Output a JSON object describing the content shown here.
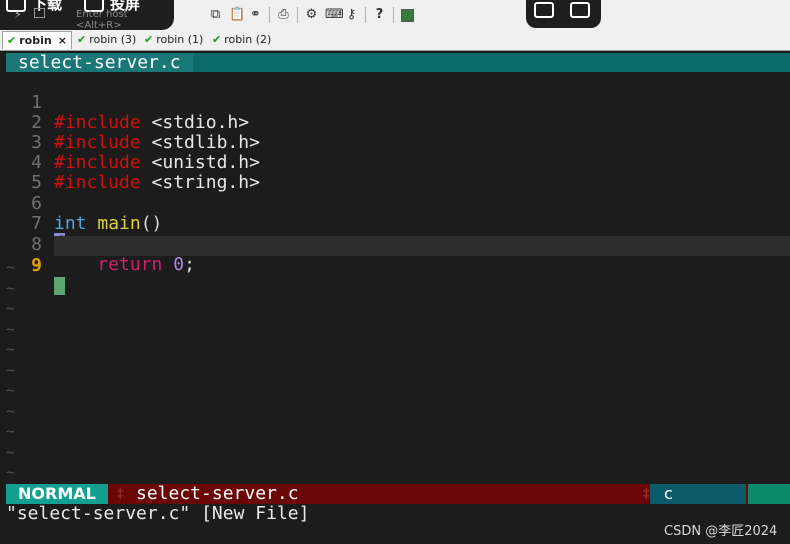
{
  "overlay": {
    "download_label": "下载",
    "cast_label": "投屏",
    "host_placeholder": "Enter host <Alt+R>"
  },
  "tabs": [
    {
      "label": "robin",
      "active": true
    },
    {
      "label": "robin (3)",
      "active": false
    },
    {
      "label": "robin (1)",
      "active": false
    },
    {
      "label": "robin (2)",
      "active": false
    }
  ],
  "tab_close_glyph": "×",
  "editor": {
    "buffer_tab": "select-server.c",
    "lines": [
      {
        "num": "1",
        "text": "#include <stdio.h>"
      },
      {
        "num": "2",
        "text": "#include <stdlib.h>"
      },
      {
        "num": "3",
        "text": "#include <unistd.h>"
      },
      {
        "num": "4",
        "text": "#include <string.h>"
      },
      {
        "num": "5",
        "text": ""
      },
      {
        "num": "6",
        "text": "int main()"
      },
      {
        "num": "7",
        "text": "{"
      },
      {
        "num": "8",
        "text": "    return 0;"
      },
      {
        "num": "9",
        "text": ""
      }
    ],
    "empty_line_marker": "~",
    "status": {
      "mode": "NORMAL",
      "file": "select-server.c",
      "filetype": "c"
    },
    "message": "\"select-server.c\" [New File]"
  },
  "watermark": "CSDN @李匠2024",
  "icons": [
    "lightning-icon",
    "window-icon",
    "copy-icon",
    "paste-icon",
    "binoculars-icon",
    "print-icon",
    "gear-icon",
    "keyboard-icon",
    "key-icon",
    "help-icon",
    "screen-icon"
  ]
}
